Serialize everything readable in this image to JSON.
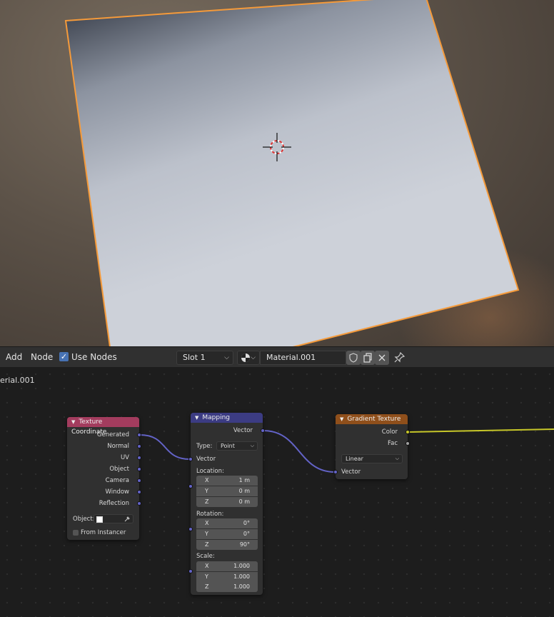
{
  "header": {
    "menu": [
      "Add",
      "Node"
    ],
    "use_nodes_label": "Use Nodes",
    "use_nodes_checked": true,
    "slot_label": "Slot 1",
    "material_name": "Material.001"
  },
  "editor": {
    "breadcrumb": "erial.001"
  },
  "nodes": {
    "texture_coordinate": {
      "title": "Texture Coordinate",
      "color": "#a33c5e",
      "outputs": [
        "Generated",
        "Normal",
        "UV",
        "Object",
        "Camera",
        "Window",
        "Reflection"
      ],
      "object_label": "Object:",
      "from_instancer_label": "From Instancer"
    },
    "mapping": {
      "title": "Mapping",
      "color": "#3c3c83",
      "output": "Vector",
      "type_label": "Type:",
      "type_value": "Point",
      "input_vector": "Vector",
      "location_label": "Location:",
      "location": [
        {
          "axis": "X",
          "value": "1 m"
        },
        {
          "axis": "Y",
          "value": "0 m"
        },
        {
          "axis": "Z",
          "value": "0 m"
        }
      ],
      "rotation_label": "Rotation:",
      "rotation": [
        {
          "axis": "X",
          "value": "0°"
        },
        {
          "axis": "Y",
          "value": "0°"
        },
        {
          "axis": "Z",
          "value": "90°"
        }
      ],
      "scale_label": "Scale:",
      "scale": [
        {
          "axis": "X",
          "value": "1.000"
        },
        {
          "axis": "Y",
          "value": "1.000"
        },
        {
          "axis": "Z",
          "value": "1.000"
        }
      ]
    },
    "gradient_texture": {
      "title": "Gradient Texture",
      "color": "#8f4f1b",
      "outputs": [
        "Color",
        "Fac"
      ],
      "gradient_type": "Linear",
      "input_vector": "Vector"
    }
  },
  "colors": {
    "vector_socket": "#6363c7",
    "color_socket": "#c7c729",
    "float_socket": "#a1a1a1",
    "selection_outline": "#f59a3a",
    "checkbox": "#4772b3"
  }
}
